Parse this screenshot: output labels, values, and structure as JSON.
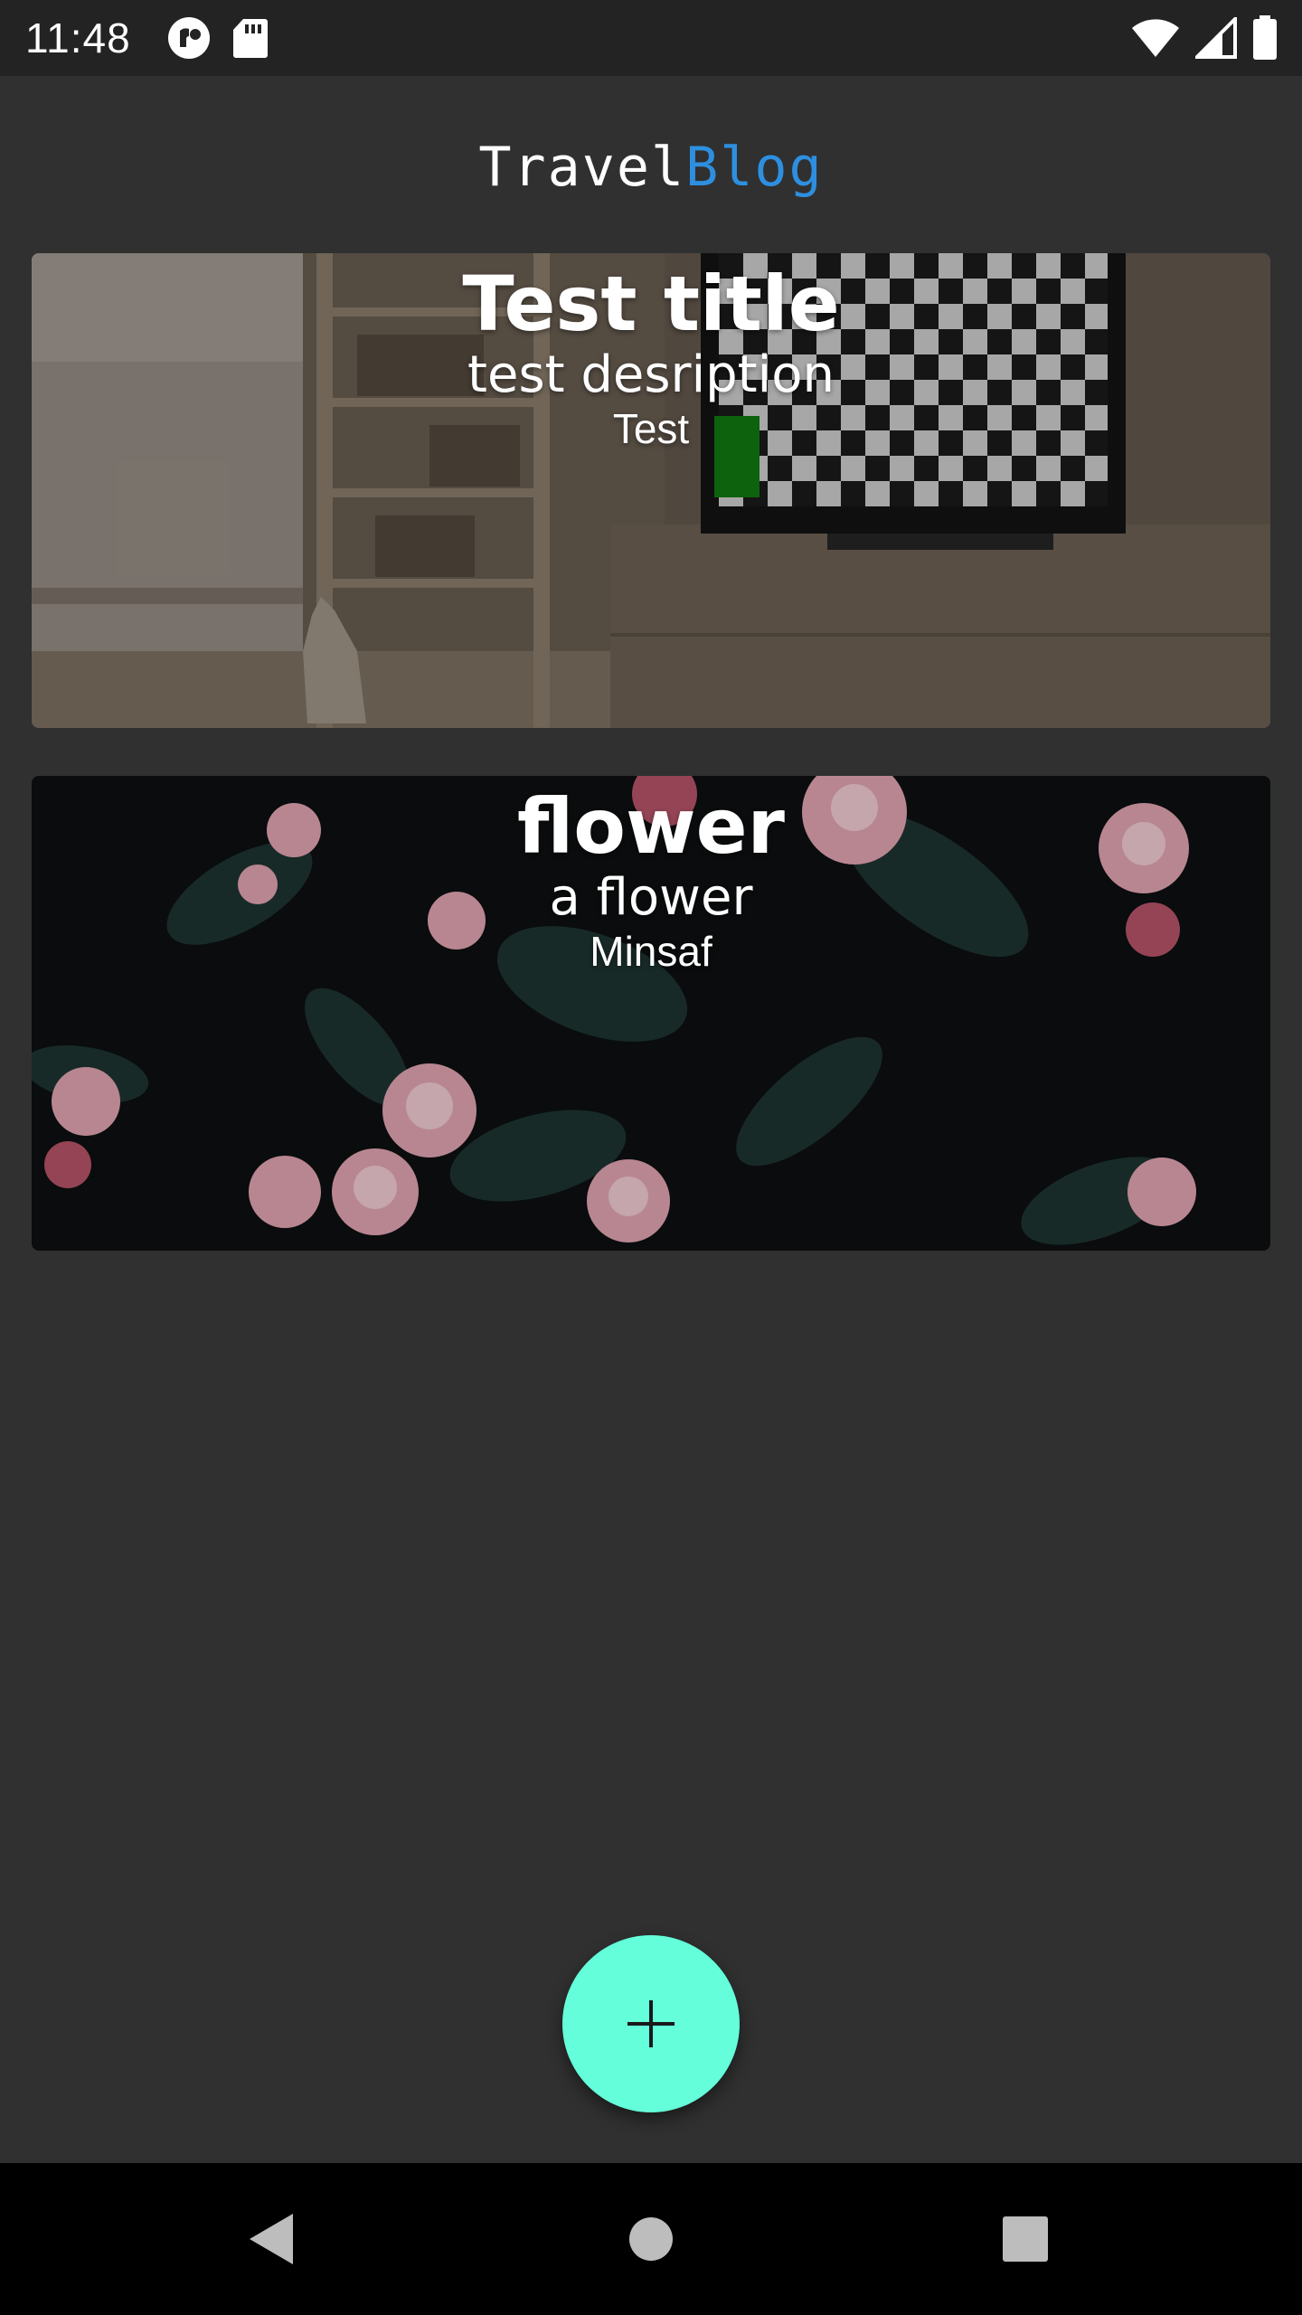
{
  "status_bar": {
    "time": "11:48",
    "left_icons": [
      "pocket-casts-icon",
      "sd-card-icon"
    ],
    "right_icons": [
      "wifi-icon",
      "cell-signal-icon",
      "battery-icon"
    ]
  },
  "header": {
    "title_part1": "Travel",
    "title_part2": "Blog",
    "accent_color": "#2e8fe0"
  },
  "posts": [
    {
      "title": "Test title",
      "description": "test desription",
      "author": "Test",
      "image": "living-room-image"
    },
    {
      "title": "flower",
      "description": "a flower",
      "author": "Minsaf",
      "image": "flowers-image"
    }
  ],
  "fab": {
    "icon": "add-icon",
    "color": "#64ffda"
  },
  "nav_bar": {
    "icons": [
      "back-icon",
      "home-icon",
      "recents-icon"
    ]
  },
  "colors": {
    "background": "#303030",
    "status_bar": "#232323",
    "nav_bar": "#000000"
  }
}
